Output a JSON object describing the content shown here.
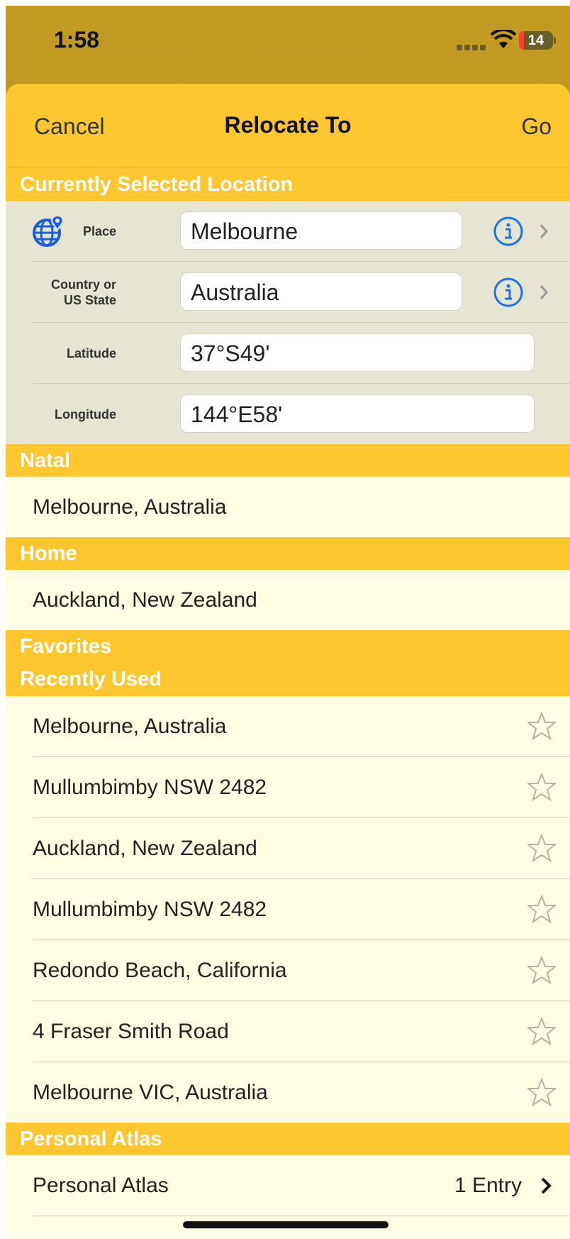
{
  "status_bar": {
    "time": "1:58",
    "battery": "14"
  },
  "nav": {
    "cancel_label": "Cancel",
    "title": "Relocate To",
    "go_label": "Go"
  },
  "current": {
    "header": "Currently Selected Location",
    "place_label": "Place",
    "place_value": "Melbourne",
    "country_label_line1": "Country or",
    "country_label_line2": "US State",
    "country_value": "Australia",
    "latitude_label": "Latitude",
    "latitude_value": "37°S49'",
    "longitude_label": "Longitude",
    "longitude_value": "144°E58'"
  },
  "natal": {
    "header": "Natal",
    "item": "Melbourne, Australia"
  },
  "home": {
    "header": "Home",
    "item": "Auckland, New Zealand"
  },
  "favorites": {
    "header": "Favorites"
  },
  "recent": {
    "header": "Recently Used",
    "items": [
      "Melbourne, Australia",
      "Mullumbimby NSW 2482",
      "Auckland, New Zealand",
      "Mullumbimby NSW 2482",
      "Redondo Beach, California",
      "4 Fraser Smith Road",
      "Melbourne VIC, Australia"
    ]
  },
  "atlas": {
    "header": "Personal Atlas",
    "label": "Personal Atlas",
    "detail": "1 Entry"
  },
  "colors": {
    "accent": "#fec730",
    "link": "#1a73e8",
    "background": "#fffde4"
  },
  "icons": [
    "globe-pin-icon",
    "info-icon",
    "chevron-right-icon",
    "star-icon",
    "wifi-icon"
  ]
}
